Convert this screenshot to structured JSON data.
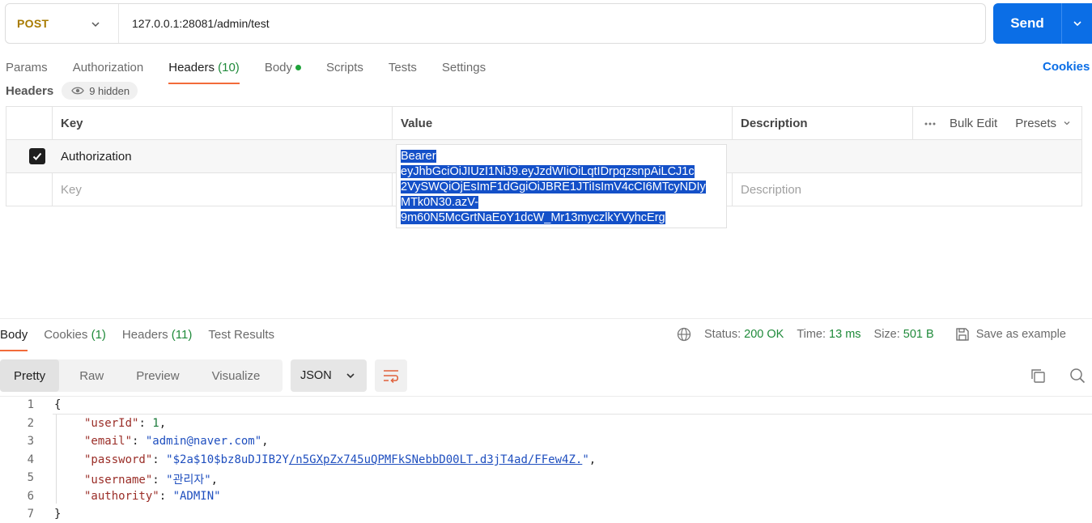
{
  "request": {
    "method": "POST",
    "url": "127.0.0.1:28081/admin/test",
    "send_label": "Send"
  },
  "request_tabs": [
    {
      "label": "Params"
    },
    {
      "label": "Authorization"
    },
    {
      "label": "Headers",
      "count": "(10)"
    },
    {
      "label": "Body"
    },
    {
      "label": "Scripts"
    },
    {
      "label": "Tests"
    },
    {
      "label": "Settings"
    }
  ],
  "cookies_link": "Cookies",
  "headers_section": {
    "title": "Headers",
    "hidden_label": "9 hidden",
    "columns": {
      "key": "Key",
      "value": "Value",
      "description": "Description"
    },
    "bulk_edit": "Bulk Edit",
    "presets": "Presets",
    "rows": [
      {
        "key": "Authorization",
        "checked": true
      }
    ],
    "placeholder": {
      "key": "Key",
      "description": "Description"
    },
    "value_popup_lines": [
      "Bearer ",
      "eyJhbGciOiJIUzI1NiJ9.eyJzdWIiOiLqtIDrpqzsnpAiLCJ1c",
      "2VySWQiOjEsImF1dGgiOiJBRE1JTiIsImV4cCI6MTcyNDIy",
      "MTk0N30.azV-",
      "9m60N5McGrtNaEoY1dcW_Mr13myczlkYVyhcErg"
    ]
  },
  "response_tabs": [
    {
      "label": "Body"
    },
    {
      "label": "Cookies",
      "count": "(1)"
    },
    {
      "label": "Headers",
      "count": "(11)"
    },
    {
      "label": "Test Results"
    }
  ],
  "response_status": {
    "status_label": "Status:",
    "status_value": "200 OK",
    "time_label": "Time:",
    "time_value": "13 ms",
    "size_label": "Size:",
    "size_value": "501 B",
    "save_example": "Save as example"
  },
  "view_tabs": [
    "Pretty",
    "Raw",
    "Preview",
    "Visualize"
  ],
  "format_select": "JSON",
  "response_body": {
    "line_numbers": [
      "1",
      "2",
      "3",
      "4",
      "5",
      "6",
      "7"
    ],
    "open_brace": "{",
    "close_brace": "}",
    "fields": [
      {
        "key": "\"userId\"",
        "value": "1",
        "type": "number"
      },
      {
        "key": "\"email\"",
        "value": "\"admin@naver.com\"",
        "type": "string"
      },
      {
        "key": "\"password\"",
        "value_prefix": "\"$2a$10$bz8uDJIB2Y",
        "value_link": "/n5GXpZx745uQPMFkSNebbD00LT.d3jT4ad/FFew4Z.",
        "value_suffix": "\"",
        "type": "string"
      },
      {
        "key": "\"username\"",
        "value": "\"관리자\"",
        "type": "string"
      },
      {
        "key": "\"authority\"",
        "value": "\"ADMIN\"",
        "type": "string"
      }
    ]
  },
  "colors": {
    "accent": "#0b6ee6",
    "method": "#a87b00",
    "active_tab_underline": "#f26b3a",
    "status_ok": "#1f8a3a",
    "selection": "#1450c8"
  }
}
